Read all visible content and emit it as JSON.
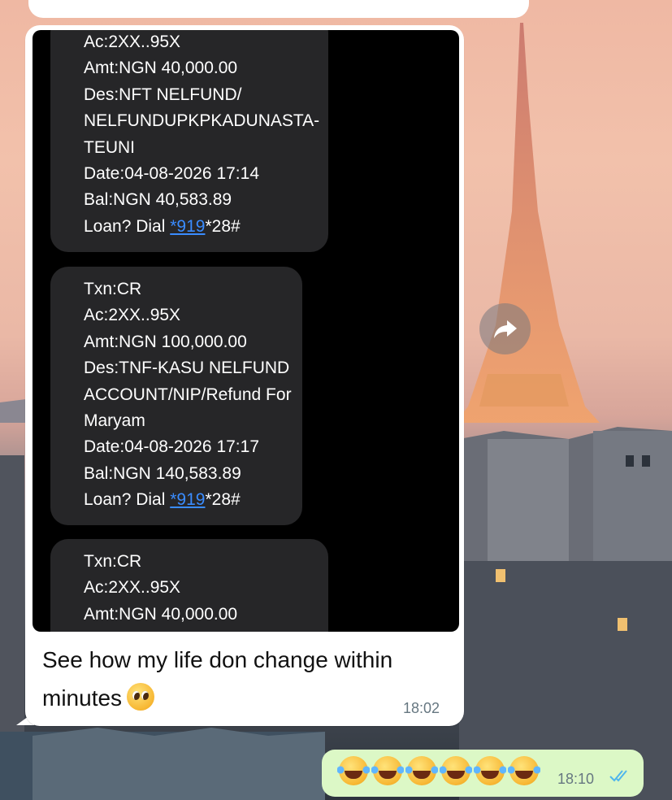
{
  "incoming_message": {
    "caption": "See how my life don change within minutes",
    "time": "18:02",
    "screenshot": {
      "block1": {
        "ac": "Ac:2XX..95X",
        "amt": "Amt:NGN 40,000.00",
        "des1": "Des:NFT NELFUND/",
        "des2": "NELFUNDUPKPKADUNASTA-",
        "des3": "TEUNI",
        "date": "Date:04-08-2026 17:14",
        "bal": "Bal:NGN 40,583.89",
        "loan_prefix": "Loan? Dial ",
        "loan_link": "*919",
        "loan_suffix": "*28#"
      },
      "block2": {
        "txn": "Txn:CR",
        "ac": "Ac:2XX..95X",
        "amt": "Amt:NGN 100,000.00",
        "des1": "Des:TNF-KASU NELFUND",
        "des2": "ACCOUNT/NIP/Refund For",
        "des3": "Maryam",
        "date": "Date:04-08-2026 17:17",
        "bal": "Bal:NGN 140,583.89",
        "loan_prefix": "Loan? Dial ",
        "loan_link": "*919",
        "loan_suffix": "*28#"
      },
      "block3": {
        "txn": "Txn:CR",
        "ac": "Ac:2XX..95X",
        "amt": "Amt:NGN 40,000.00"
      }
    },
    "emoji": "pleading-face"
  },
  "outgoing_message": {
    "emojis": [
      "face-with-tears-of-joy",
      "face-with-tears-of-joy",
      "face-with-tears-of-joy",
      "face-with-tears-of-joy",
      "face-with-tears-of-joy",
      "face-with-tears-of-joy"
    ],
    "time": "18:10",
    "status": "read"
  },
  "colors": {
    "incoming_bubble": "#ffffff",
    "outgoing_bubble": "#dcf8c6",
    "sms_bubble": "#262628",
    "link": "#3a8cff",
    "read_ticks": "#4fb6ec"
  }
}
